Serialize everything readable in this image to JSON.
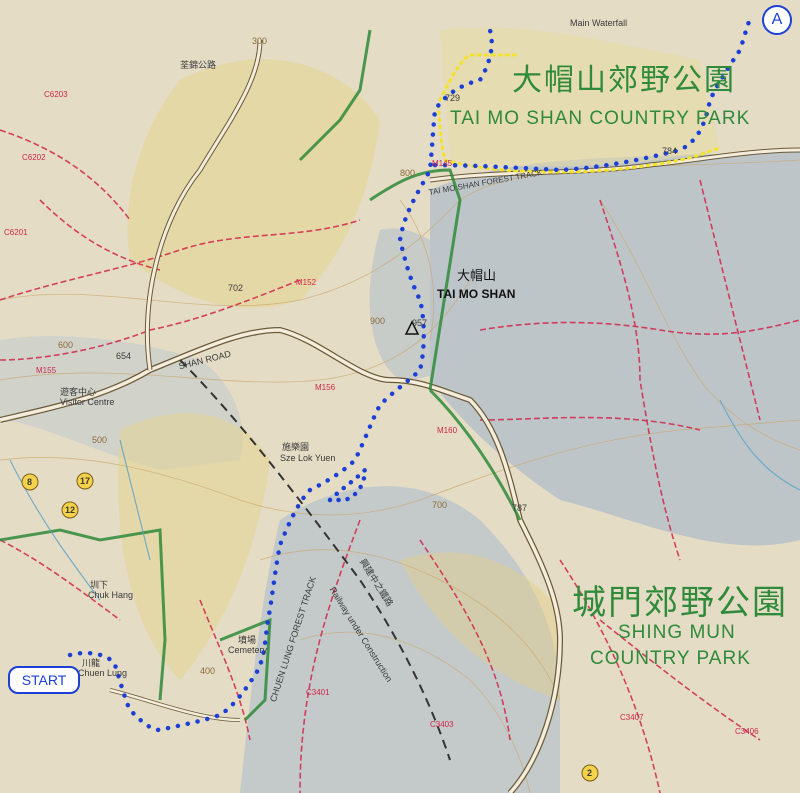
{
  "parks": {
    "tai_mo_shan_zh": "大帽山郊野公園",
    "tai_mo_shan_en": "TAI MO SHAN COUNTRY PARK",
    "shing_mun_zh": "城門郊野公園",
    "shing_mun_en_1": "SHING MUN",
    "shing_mun_en_2": "COUNTRY PARK"
  },
  "peak": {
    "zh": "大帽山",
    "en": "TAI MO SHAN",
    "height": "957"
  },
  "places": {
    "forest_track": "TAI MO SHAN FOREST TRACK",
    "visitor_centre_zh": "遊客中心",
    "visitor_centre_en": "Visitor Centre",
    "sze_lok_yuen_zh": "施樂園",
    "sze_lok_yuen_en": "Sze Lok Yuen",
    "chuen_lung_zh": "川龍",
    "chuen_lung_en": "Chuen Lung",
    "chuk_hang_zh": "圳下",
    "chuk_hang_en": "Chuk Hang",
    "cemetery_zh": "墳場",
    "cemetery_en": "Cemetery",
    "chuen_lung_track": "CHUEN LUNG FOREST TRACK",
    "railway": "Railway under Construction",
    "railway_zh": "興建中之鐵路",
    "waterfall_en": "Main Waterfall",
    "road": "SHAN ROAD",
    "road_zh": "荃錦公路"
  },
  "codes": {
    "m145": "M145",
    "m152": "M152",
    "m155": "M155",
    "m156": "M156",
    "c6203": "C6203",
    "c6202": "C6202",
    "c6201": "C6201",
    "c3401": "C3401",
    "c3403": "C3403",
    "c3407": "C3407",
    "c3406": "C3406",
    "m160": "M160"
  },
  "spot_heights": {
    "h784": "784",
    "h702": "702",
    "h654": "654",
    "h729": "729",
    "h787": "787"
  },
  "contours": {
    "c300": "300",
    "c400": "400",
    "c500": "500",
    "c600": "600",
    "c700": "700",
    "c800": "800",
    "c900": "900"
  },
  "markers": {
    "start": "START",
    "a": "A",
    "n17": "17",
    "n12": "12",
    "n8": "8",
    "n2": "2"
  },
  "colors": {
    "route": "#1c3fd6",
    "boundary": "#f2e22a",
    "park_boundary": "#2f8a3a",
    "trail": "#d0264a",
    "land": "#e4dcc4",
    "terrain": "#b9c3cb"
  }
}
